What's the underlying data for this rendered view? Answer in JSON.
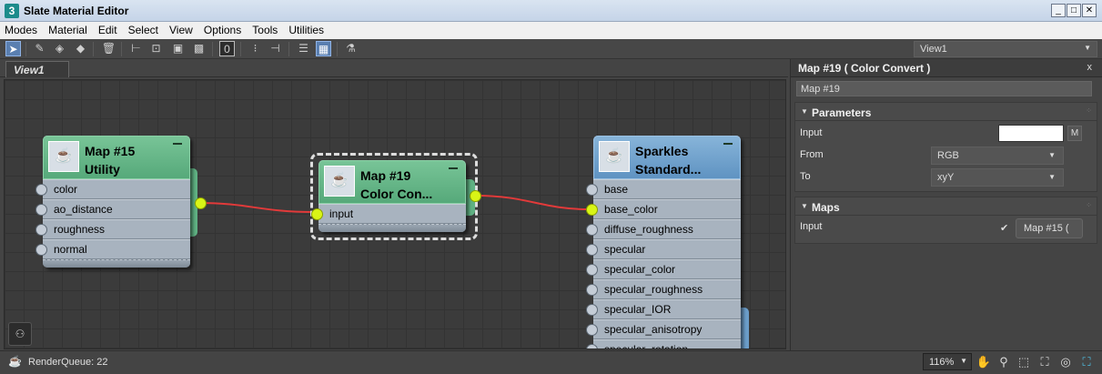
{
  "window": {
    "title": "Slate Material Editor",
    "app_icon": "3",
    "minimize": "_",
    "maximize": "□",
    "close": "✕"
  },
  "menu": [
    "Modes",
    "Material",
    "Edit",
    "Select",
    "View",
    "Options",
    "Tools",
    "Utilities"
  ],
  "toolbar": {
    "view_select": "View1"
  },
  "view_tab": "View1",
  "nodes": {
    "map15": {
      "title_line1": "Map #15",
      "title_line2": "Utility",
      "slots": [
        "color",
        "ao_distance",
        "roughness",
        "normal"
      ]
    },
    "map19": {
      "title_line1": "Map #19",
      "title_line2": "Color Con...",
      "slots": [
        "input"
      ]
    },
    "sparkles": {
      "title_line1": "Sparkles",
      "title_line2": "Standard...",
      "slots": [
        "base",
        "base_color",
        "diffuse_roughness",
        "specular",
        "specular_color",
        "specular_roughness",
        "specular_IOR",
        "specular_anisotropy",
        "specular_rotation"
      ]
    }
  },
  "status": {
    "render_queue": "RenderQueue: 22",
    "zoom": "116%"
  },
  "panel": {
    "header": "Map #19  ( Color Convert )",
    "close": "x",
    "name_value": "Map #19",
    "parameters": {
      "title": "Parameters",
      "input_label": "Input",
      "m_button": "M",
      "from_label": "From",
      "from_value": "RGB",
      "to_label": "To",
      "to_value": "xyY"
    },
    "maps": {
      "title": "Maps",
      "input_label": "Input",
      "check": "✔",
      "map_button": "Map #15 ("
    }
  },
  "colors": {
    "node_green": "#5fb183",
    "node_blue": "#6b9dc9",
    "wire": "#e23a3a",
    "socket_lit": "#d9f516"
  }
}
